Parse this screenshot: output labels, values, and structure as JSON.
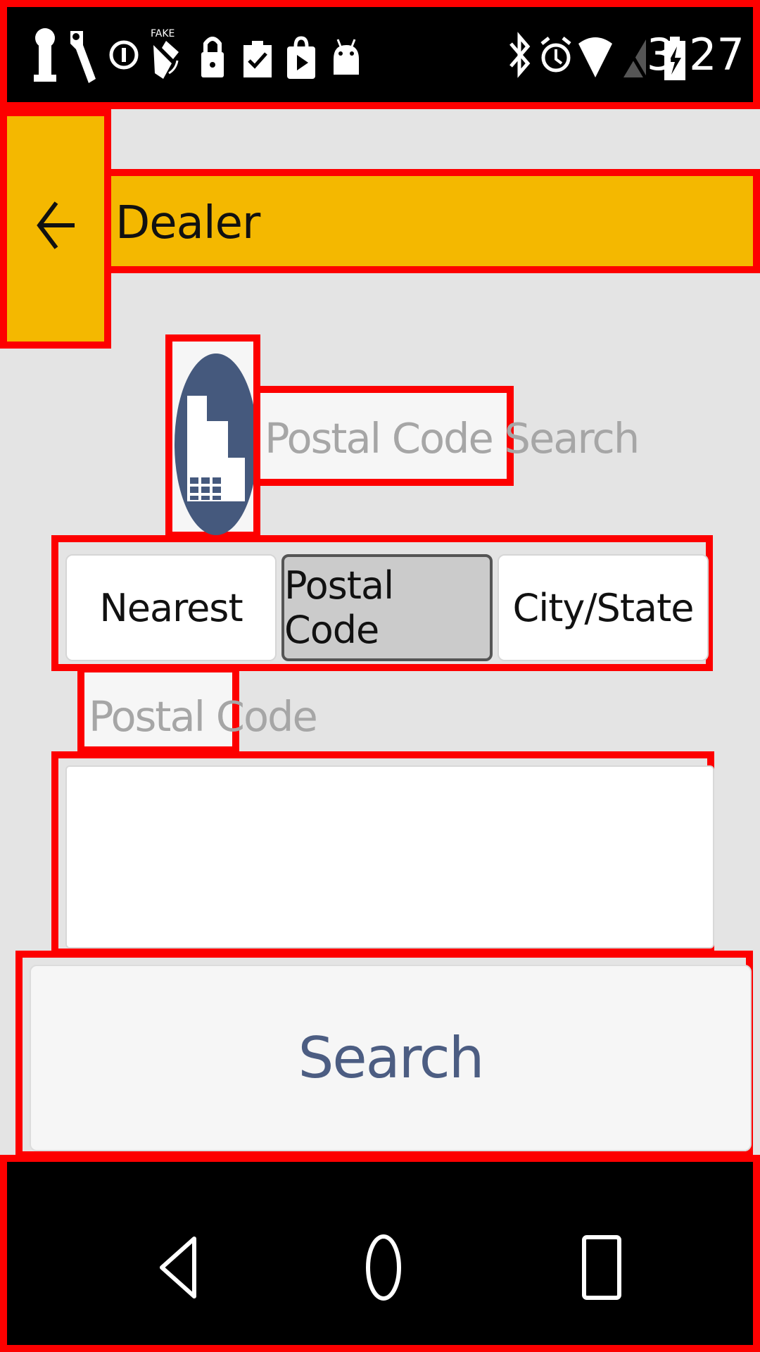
{
  "status_bar": {
    "time": "3:27",
    "left_icons": [
      "keyhole-icon",
      "wrench-icon",
      "circle-one-icon",
      "fake-gps-icon",
      "lock-icon",
      "clipboard-check-icon",
      "play-store-bag-icon",
      "android-icon"
    ],
    "right_icons": [
      "bluetooth-icon",
      "alarm-icon",
      "wifi-icon",
      "no-signal-icon",
      "battery-charging-icon"
    ]
  },
  "header": {
    "back_icon": "back-arrow-icon",
    "title": "Dealer",
    "accent_color": "#f4b800"
  },
  "dealer_icon": {
    "icon": "dealer-building-icon",
    "color": "#45597d"
  },
  "search_label": "Postal Code Search",
  "segments": {
    "items": [
      {
        "label": "Nearest",
        "selected": false
      },
      {
        "label": "Postal Code",
        "selected": true
      },
      {
        "label": "City/State",
        "selected": false
      }
    ]
  },
  "postal_field": {
    "label": "Postal Code",
    "value": ""
  },
  "search_button": {
    "label": "Search",
    "text_color": "#4c5d82"
  },
  "nav_bar": {
    "icons": [
      "nav-back-icon",
      "nav-home-icon",
      "nav-recents-icon"
    ]
  },
  "annotation_color": "#fd0000"
}
